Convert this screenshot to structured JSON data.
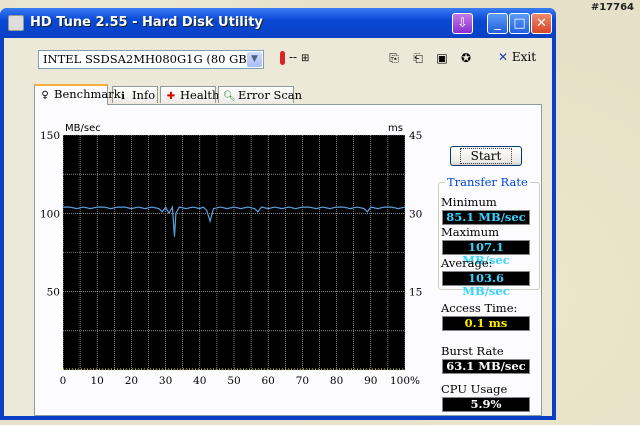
{
  "watermark": "#17764",
  "window": {
    "title": "HD Tune 2.55 - Hard Disk Utility",
    "minimize": "_",
    "maximize": "□",
    "close": "✕"
  },
  "toolbar": {
    "drive": "INTEL SSDSA2MH080G1G (80 GB)",
    "temperature": "--",
    "exit_label": "Exit"
  },
  "tabs": [
    {
      "label": "Benchmark",
      "icon": "benchmark-icon",
      "active": true
    },
    {
      "label": "Info",
      "icon": "info-icon",
      "active": false
    },
    {
      "label": "Health",
      "icon": "health-cross-icon",
      "active": false
    },
    {
      "label": "Error Scan",
      "icon": "magnifier-icon",
      "active": false
    }
  ],
  "start_button": "Start",
  "transfer_rate": {
    "title": "Transfer Rate",
    "minimum_label": "Minimum",
    "minimum": "85.1 MB/sec",
    "maximum_label": "Maximum",
    "maximum": "107.1 MB/sec",
    "average_label": "Average:",
    "average": "103.6 MB/sec"
  },
  "access_time": {
    "label": "Access Time:",
    "value": "0.1 ms"
  },
  "burst_rate": {
    "label": "Burst Rate",
    "value": "63.1 MB/sec"
  },
  "cpu_usage": {
    "label": "CPU Usage",
    "value": "5.9%"
  },
  "colors": {
    "transfer_line": "#5aa0e0",
    "access_points": "#e8e000",
    "plot_bg": "#000000",
    "grid": "#d8d8d8"
  },
  "chart_data": {
    "type": "line",
    "ylabel_left": "MB/sec",
    "ylabel_right": "ms",
    "xlim": [
      0,
      100
    ],
    "ylim_left": [
      0,
      150
    ],
    "ylim_right": [
      0,
      45
    ],
    "x_ticks": [
      "0",
      "10",
      "20",
      "30",
      "40",
      "50",
      "60",
      "70",
      "80",
      "90",
      "100%"
    ],
    "y_ticks_left": [
      "150",
      "100",
      "50"
    ],
    "y_ticks_right": [
      "45",
      "30",
      "15"
    ],
    "grid": true,
    "series": [
      {
        "name": "",
        "axis": "left",
        "x": [
          0,
          2,
          4,
          6,
          8,
          10,
          12,
          14,
          16,
          18,
          20,
          22,
          24,
          26,
          28,
          29,
          30,
          31,
          32,
          32.6,
          33,
          34,
          36,
          38,
          40,
          41,
          42,
          43,
          44,
          46,
          48,
          50,
          52,
          54,
          56,
          57,
          58,
          60,
          62,
          64,
          66,
          68,
          70,
          72,
          74,
          76,
          78,
          80,
          82,
          84,
          86,
          88,
          89,
          90,
          92,
          94,
          96,
          98,
          100
        ],
        "y": [
          104,
          104,
          103,
          104,
          103,
          104,
          104,
          103,
          104,
          104,
          103,
          104,
          103,
          104,
          103,
          101,
          104,
          100,
          104,
          85.1,
          100,
          104,
          103,
          104,
          103,
          104,
          102,
          95,
          103,
          104,
          103,
          104,
          103,
          104,
          103,
          101,
          104,
          103,
          104,
          103,
          104,
          103,
          104,
          104,
          103,
          104,
          103,
          104,
          104,
          103,
          104,
          103,
          101,
          104,
          103,
          104,
          104,
          103,
          104
        ]
      }
    ]
  }
}
